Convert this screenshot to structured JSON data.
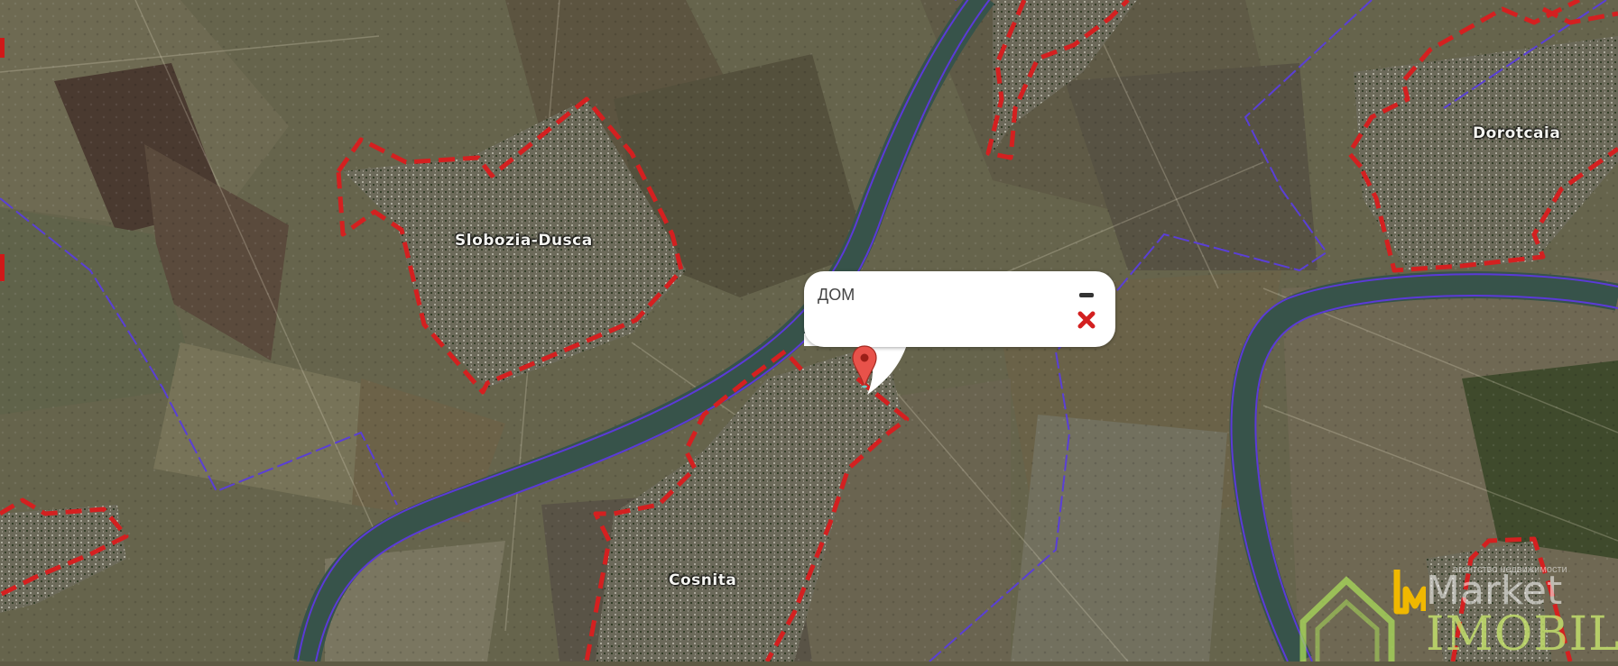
{
  "map": {
    "type": "satellite",
    "places": [
      {
        "name": "Slobozia-Dusca"
      },
      {
        "name": "Dorotcaia"
      },
      {
        "name": "Cosnita"
      }
    ],
    "colors": {
      "boundary_dashed": "#d42020",
      "border_line": "#5a3fd6",
      "river": "#38524a",
      "river_edge": "#5b3ad8"
    }
  },
  "popup": {
    "title": "ДОМ",
    "minimize_icon": "minus-icon",
    "close_icon": "close-x-icon",
    "close_color": "#d32020"
  },
  "marker": {
    "icon": "map-pin-icon",
    "color": "#e8524a"
  },
  "logo": {
    "word1": "Market",
    "word2": "IMOBILE",
    "tagline": "агентство недвижимости",
    "accent": "#f0b800"
  }
}
